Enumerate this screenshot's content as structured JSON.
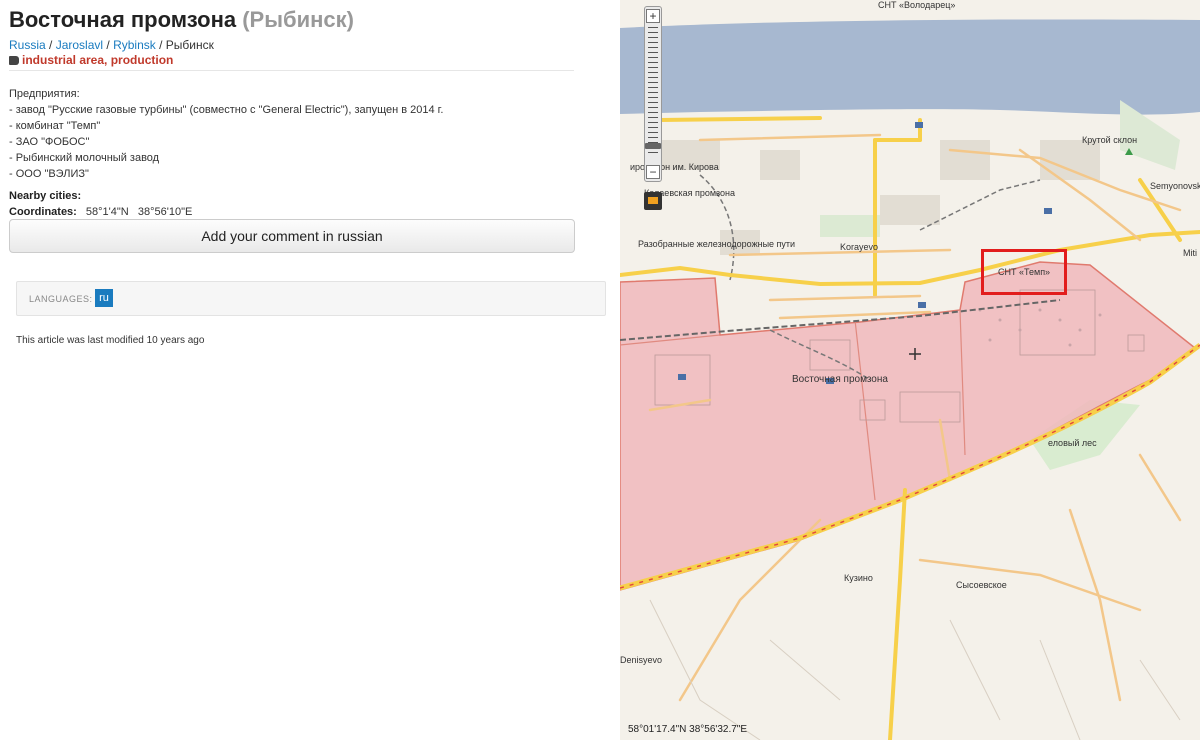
{
  "article": {
    "title": "Восточная промзона",
    "subtitle": "(Рыбинск)",
    "breadcrumb": [
      "Russia",
      "Jaroslavl",
      "Rybinsk",
      "Рыбинск"
    ],
    "tags": [
      "industrial area",
      "production"
    ],
    "description": [
      "Предприятия:",
      "- завод \"Русские газовые турбины\" (совместно с \"General Electric\"), запущен в 2014 г.",
      "- комбинат \"Темп\"",
      "- ЗАО \"ФОБОС\"",
      "- Рыбинский молочный завод",
      "- ООО \"ВЭЛИЗ\""
    ],
    "nearby_label": "Nearby cities:",
    "coordinates_label": "Coordinates:",
    "coordinates_value": "58°1'4\"N   38°56'10\"E",
    "comment_button": "Add your comment in russian",
    "languages_label": "LANGUAGES:",
    "language_code": "ru",
    "modified": "This article was last modified 10 years ago"
  },
  "map": {
    "zoom_in": "+",
    "zoom_out": "−",
    "labels": {
      "snt_volodarets": "СНТ «Володарец»",
      "krutoy_sklon": "Крутой склон",
      "semyonovskoe": "Semyonovsko",
      "mikrorayon_kirova": "ирорайон им. Кирова",
      "kolaevskaya": "Колаевская промзона",
      "razobrannye": "Разобранные железнодорожные пути",
      "korayevo": "Korayevo",
      "snt_temp": "СНТ «Темп»",
      "mitino": "Miti",
      "vostochnaya": "Восточная промзона",
      "elovy_les": "еловый лес",
      "kuzino": "Кузино",
      "sysoevskoe": "Сысоевское",
      "denisyevo": "Denisyevo"
    },
    "coordinate_readout": "58°01'17.4\"N 38°56'32.7\"E",
    "colors": {
      "water": "#a7b8d0",
      "industrial_zone": "#f0b8bc",
      "zone_border": "#e07a6e",
      "major_road": "#f7d04a",
      "road": "#f3c78a",
      "highlight": "#e21d1d",
      "forest": "#d9ecd0"
    }
  }
}
